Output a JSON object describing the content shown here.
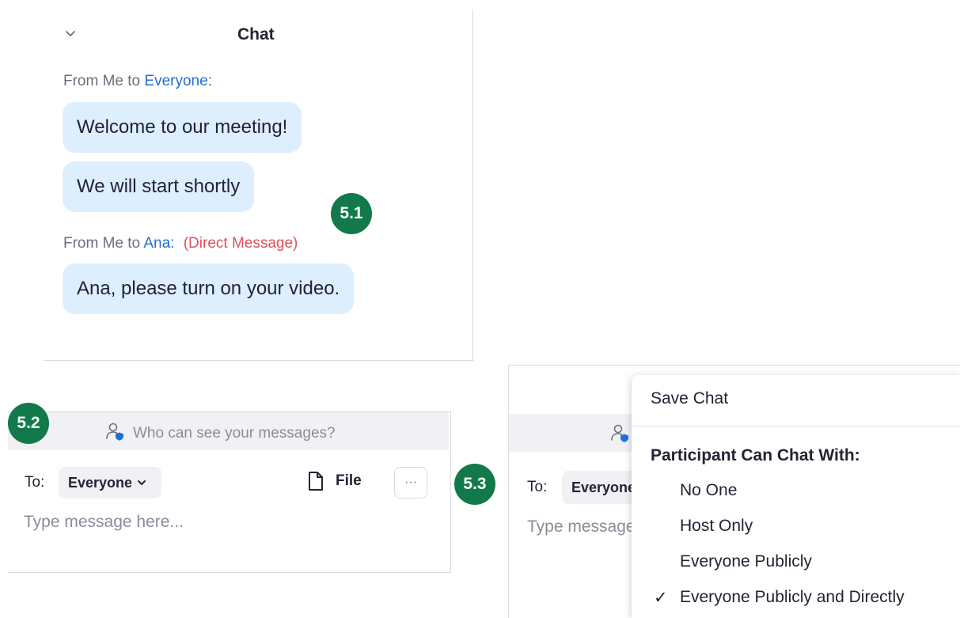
{
  "chat_panel": {
    "title": "Chat",
    "messages": [
      {
        "from_prefix": "From Me to",
        "to_name": "Everyone",
        "to_suffix": ":",
        "bubbles": [
          "Welcome to our meeting!",
          "We will start shortly"
        ]
      },
      {
        "from_prefix": "From Me to",
        "to_name": "Ana",
        "to_suffix": ":",
        "dm_tag": "(Direct Message)",
        "bubbles": [
          "Ana, please turn on your video."
        ]
      }
    ]
  },
  "badges": [
    "5.1",
    "5.2",
    "5.3"
  ],
  "compose": {
    "visibility_text": "Who can see your messages?",
    "to_label": "To:",
    "to_value": "Everyone",
    "file_label": "File",
    "more_label": "···",
    "placeholder": "Type message here..."
  },
  "compose_2": {
    "to_label": "To:",
    "to_value": "Everyone",
    "placeholder": "Type message here..."
  },
  "menu": {
    "save_chat": "Save Chat",
    "header": "Participant Can Chat With:",
    "options": [
      "No One",
      "Host Only",
      "Everyone Publicly",
      "Everyone Publicly and Directly"
    ],
    "checked_index": 3,
    "check_glyph": "✓"
  },
  "colors": {
    "accent_blue": "#1f6fd6",
    "direct_message_red": "#e0505a",
    "bubble_bg": "#ddeefe",
    "badge_green": "#127a4a"
  }
}
